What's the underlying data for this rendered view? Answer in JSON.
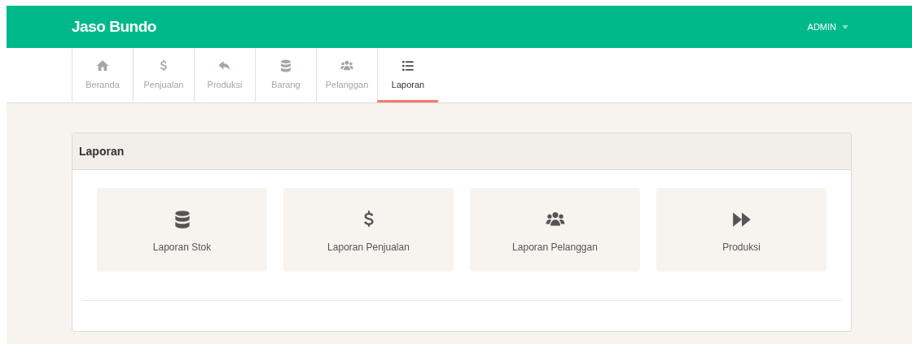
{
  "navbar": {
    "brand": "Jaso Bundo",
    "user_menu": "ADMIN"
  },
  "tabs": [
    {
      "label": "Beranda",
      "kind": "home",
      "selected": false
    },
    {
      "label": "Penjualan",
      "kind": "dollar",
      "selected": false
    },
    {
      "label": "Produksi",
      "kind": "reply",
      "selected": false
    },
    {
      "label": "Barang",
      "kind": "database",
      "selected": false
    },
    {
      "label": "Pelanggan",
      "kind": "users",
      "selected": false
    },
    {
      "label": "Laporan",
      "kind": "list",
      "selected": true
    }
  ],
  "panel": {
    "title": "Laporan",
    "tiles": [
      {
        "label": "Laporan Stok",
        "kind": "database"
      },
      {
        "label": "Laporan Penjualan",
        "kind": "dollar"
      },
      {
        "label": "Laporan Pelanggan",
        "kind": "users"
      },
      {
        "label": "Produksi",
        "kind": "forward"
      }
    ]
  }
}
